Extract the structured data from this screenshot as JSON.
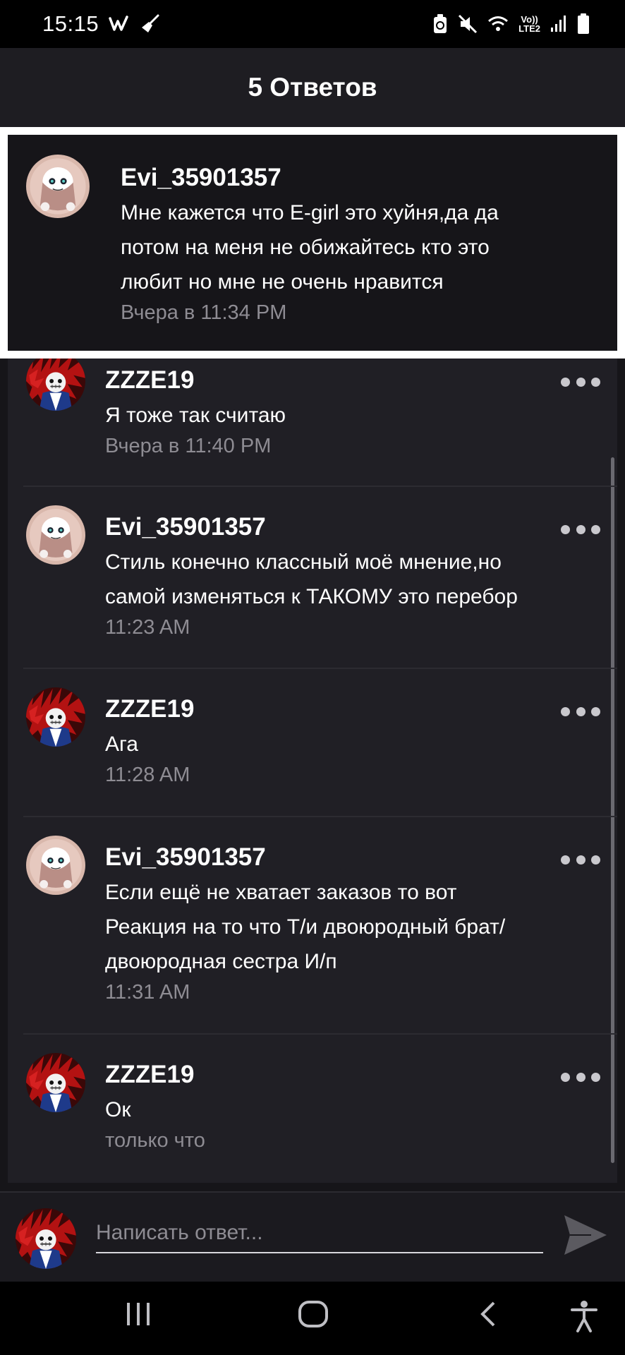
{
  "status_bar": {
    "time": "15:15",
    "lte_top": "Vo))",
    "lte_bottom": "LTE2"
  },
  "header": {
    "title": "5 Ответов"
  },
  "parent_comment": {
    "username": "Evi_35901357",
    "text_lines": [
      "Мне кажется что E-girl это хуйня,да да",
      "потом на меня не обижайтесь кто это",
      "любит но мне не очень нравится"
    ],
    "timestamp": "Вчера в 11:34 PM",
    "avatar": "ghost-avatar"
  },
  "replies": [
    {
      "username": "ZZZE19",
      "text_lines": [
        "Я тоже так считаю"
      ],
      "timestamp": "Вчера в 11:40 PM",
      "avatar": "skeleton-avatar"
    },
    {
      "username": "Evi_35901357",
      "text_lines": [
        "Стиль конечно классный моё мнение,но",
        "самой изменяться к ТАКОМУ это перебор"
      ],
      "timestamp": "11:23 AM",
      "avatar": "ghost-avatar"
    },
    {
      "username": "ZZZE19",
      "text_lines": [
        "Ага"
      ],
      "timestamp": "11:28 AM",
      "avatar": "skeleton-avatar"
    },
    {
      "username": "Evi_35901357",
      "text_lines": [
        "Если ещё не хватает заказов то вот",
        "Реакция на то что Т/и двоюродный брат/",
        "двоюродная сестра И/п"
      ],
      "timestamp": "11:31 AM",
      "avatar": "ghost-avatar"
    },
    {
      "username": "ZZZE19",
      "text_lines": [
        "Ок"
      ],
      "timestamp": "только что",
      "avatar": "skeleton-avatar"
    }
  ],
  "reply_input": {
    "placeholder": "Написать ответ...",
    "value": ""
  },
  "colors": {
    "background": "#161519",
    "card": "#201f25",
    "header": "#1e1d22",
    "timestamp": "#8e8c93",
    "highlight_border": "#ffffff"
  },
  "icons": {
    "status_left": [
      "w-app-icon",
      "broom-icon"
    ],
    "status_right": [
      "battery-saver-icon",
      "mute-icon",
      "wifi-icon",
      "lte-icon",
      "signal-icon",
      "battery-icon"
    ],
    "nav": [
      "recent-apps-icon",
      "home-icon",
      "back-icon",
      "accessibility-icon"
    ],
    "send": "send-icon",
    "more": "more-options-icon"
  }
}
